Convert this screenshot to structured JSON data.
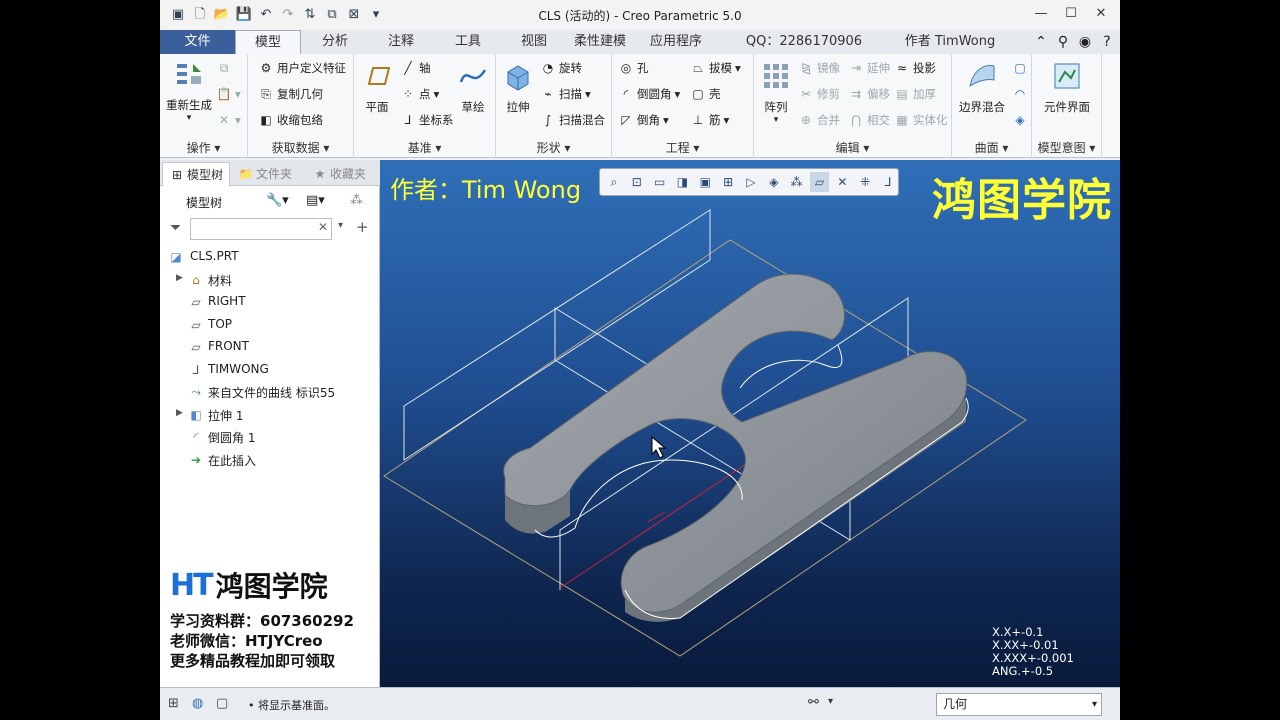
{
  "window": {
    "title": "CLS (活动的) - Creo Parametric 5.0",
    "controls": [
      "—",
      "☐",
      "✕"
    ]
  },
  "tabs": [
    {
      "label": "文件"
    },
    {
      "label": "模型"
    },
    {
      "label": "分析"
    },
    {
      "label": "注释"
    },
    {
      "label": "工具"
    },
    {
      "label": "视图"
    },
    {
      "label": "柔性建模"
    },
    {
      "label": "应用程序"
    },
    {
      "label": "QQ：2286170906"
    },
    {
      "label": "作者 TimWong"
    }
  ],
  "ribbon": {
    "operations": {
      "label": "操作",
      "regenerate": "重新生成"
    },
    "get_data": {
      "label": "获取数据",
      "udf": "用户定义特征",
      "copy_geom": "复制几何",
      "shrinkwrap": "收缩包络"
    },
    "datum": {
      "label": "基准",
      "plane": "平面",
      "axis": "轴",
      "point": "点",
      "csys": "坐标系",
      "sketch": "草绘"
    },
    "shapes": {
      "label": "形状",
      "extrude": "拉伸",
      "revolve": "旋转",
      "sweep": "扫描",
      "swept_blend": "扫描混合"
    },
    "engineering": {
      "label": "工程",
      "hole": "孔",
      "round": "倒圆角",
      "chamfer": "倒角",
      "draft": "拔模",
      "shell": "壳",
      "rib": "筋"
    },
    "editing": {
      "label": "编辑",
      "pattern": "阵列",
      "mirror": "镜像",
      "trim": "修剪",
      "merge": "合并",
      "extend": "延伸",
      "offset": "偏移",
      "intersect": "相交",
      "project": "投影",
      "thicken": "加厚",
      "solidify": "实体化"
    },
    "surfaces": {
      "label": "曲面",
      "boundary_blend": "边界混合"
    },
    "model_intent": {
      "label": "模型意图",
      "component_interface": "元件界面"
    }
  },
  "left_panel": {
    "tabs": [
      "模型树",
      "文件夹",
      "收藏夹"
    ],
    "tree_header": "模型树",
    "filter_value": "",
    "items": [
      {
        "label": "CLS.PRT",
        "icon": "part-icon"
      },
      {
        "label": "材料",
        "icon": "material-icon"
      },
      {
        "label": "RIGHT",
        "icon": "datum-plane-icon"
      },
      {
        "label": "TOP",
        "icon": "datum-plane-icon"
      },
      {
        "label": "FRONT",
        "icon": "datum-plane-icon"
      },
      {
        "label": "TIMWONG",
        "icon": "csys-icon"
      },
      {
        "label": "来自文件的曲线 标识55",
        "icon": "curve-icon"
      },
      {
        "label": "拉伸 1",
        "icon": "extrude-icon"
      },
      {
        "label": "倒圆角 1",
        "icon": "round-icon"
      },
      {
        "label": "在此插入",
        "icon": "insert-here-icon"
      }
    ]
  },
  "promo": {
    "logo_letters": "HT",
    "logo_text": "鸿图学院",
    "line1": "学习资料群：607360292",
    "line2": "老师微信：HTJYCreo",
    "line3": "更多精品教程加即可领取"
  },
  "viewport": {
    "author": "作者：Tim Wong",
    "brand": "鸿图学院",
    "tolerances": [
      "X.X+-0.1",
      "X.XX+-0.01",
      "X.XXX+-0.001",
      "ANG.+-0.5"
    ],
    "colors": {
      "part": "#8a9099",
      "bg_top": "#2f6fb8",
      "bg_bottom": "#091a3b",
      "datum": "#b8a27a",
      "axis": "#d0203a"
    }
  },
  "status": {
    "message": "• 将显示基准面。",
    "selection_filter": "几何"
  }
}
